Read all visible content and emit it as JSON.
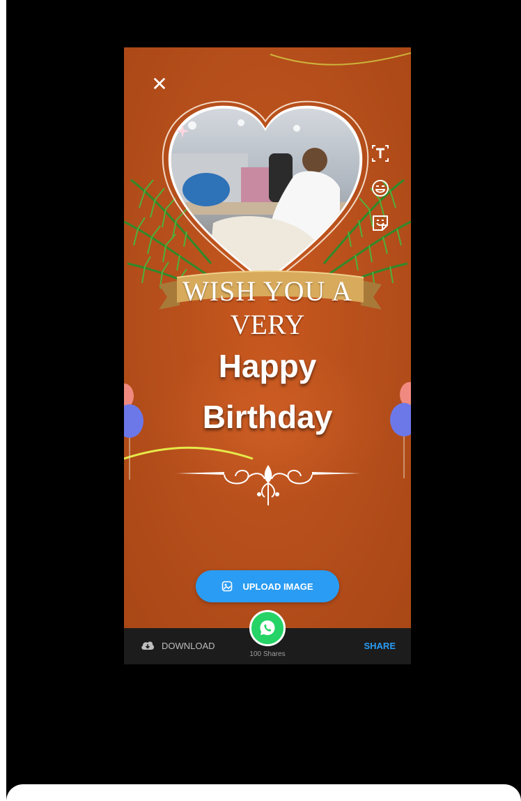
{
  "card": {
    "wish_line": "WISH YOU A",
    "very_line": "VERY",
    "happy_line": "Happy",
    "birthday_line": "Birthday",
    "upload_label": "UPLOAD IMAGE"
  },
  "toolbar": {
    "close_symbol": "✕",
    "tools": [
      "text-tool-icon",
      "emoji-tool-icon",
      "sticker-tool-icon"
    ]
  },
  "bottom_bar": {
    "download_label": "DOWNLOAD",
    "shares_label": "100 Shares",
    "share_label": "SHARE"
  },
  "colors": {
    "card_bg": "#b8501c",
    "accent_blue": "#2a9cf3",
    "whatsapp_green": "#25d366",
    "bar_bg": "#1c1c1c"
  }
}
